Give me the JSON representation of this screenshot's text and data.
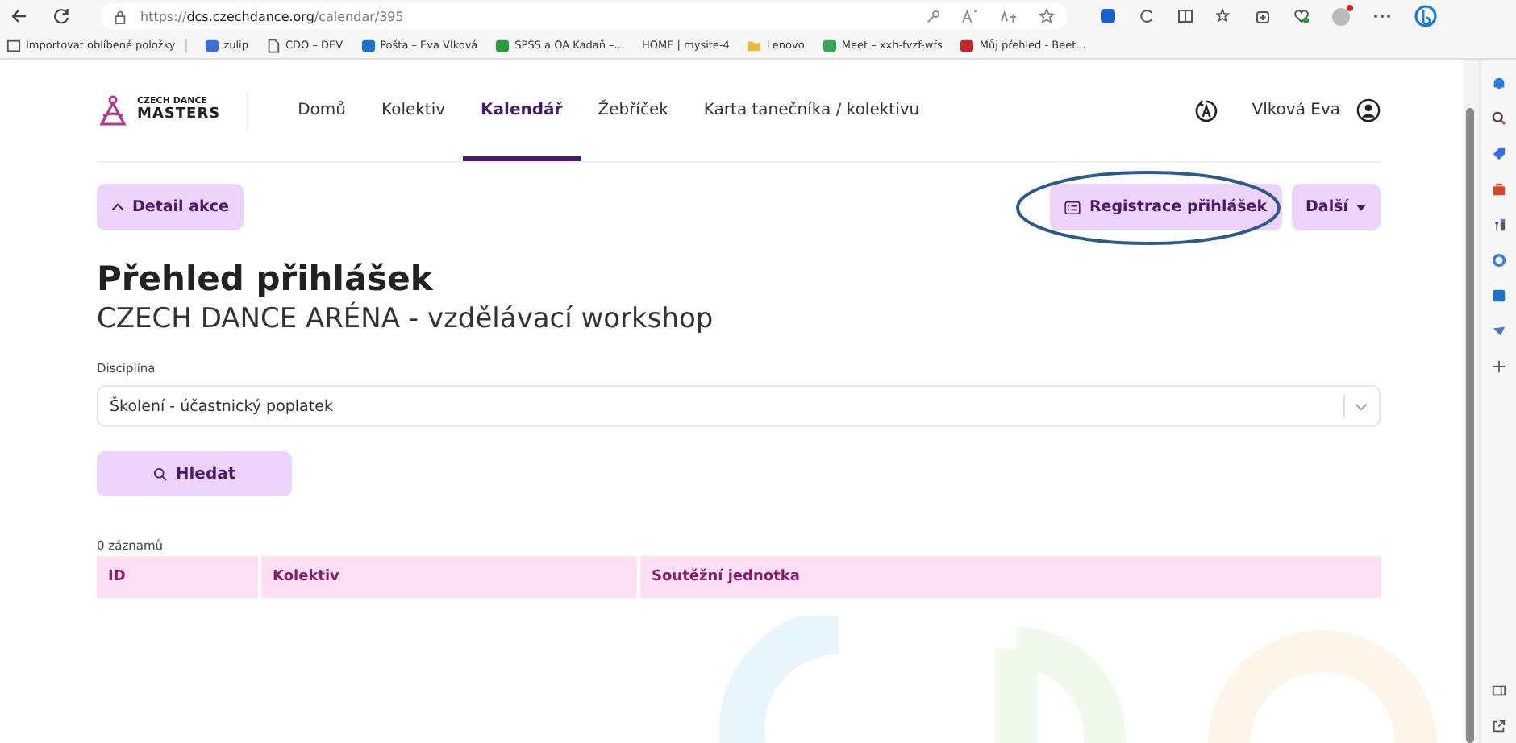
{
  "browser": {
    "url": "https://**dcs.czechdance.org**/calendar/395",
    "bookmarks": [
      {
        "label": "Importovat oblíbené položky",
        "kind": "import"
      },
      {
        "label": "zulip",
        "kind": "zulip"
      },
      {
        "label": "CDO – DEV",
        "kind": "page"
      },
      {
        "label": "Pošta – Eva Vlková",
        "kind": "mail"
      },
      {
        "label": "SPŠS a OA Kadaň –...",
        "kind": "school"
      },
      {
        "label": "HOME | mysite-4",
        "kind": "none"
      },
      {
        "label": "Lenovo",
        "kind": "folder"
      },
      {
        "label": "Meet – xxh-fvzf-wfs",
        "kind": "meet"
      },
      {
        "label": "Můj přehled - Beet...",
        "kind": "beet"
      }
    ],
    "profile_badge": true
  },
  "site": {
    "logo": {
      "line_1": "CZECH DANCE",
      "line_2": "MASTERS"
    },
    "nav": [
      {
        "label": "Domů",
        "selected": false
      },
      {
        "label": "Kolektiv",
        "selected": false
      },
      {
        "label": "Kalendář",
        "selected": true
      },
      {
        "label": "Žebříček",
        "selected": false
      },
      {
        "label": "Karta tanečníka / kolektivu",
        "selected": false
      }
    ],
    "user": "Vlková Eva"
  },
  "toolbar": {
    "back_button": "Detail akce",
    "register_button": "Registrace přihlášek",
    "more_button": "Další",
    "annotation_circled": true
  },
  "title": "Přehled přihlášek",
  "subtitle": "CZECH DANCE ARÉNA - vzdělávací workshop",
  "filter": {
    "label": "Disciplína",
    "value": "Školení - účastnický poplatek"
  },
  "search_button": "Hledat",
  "count": "0 záznamů",
  "table": {
    "columns": [
      "ID",
      "Kolektiv",
      "Soutěžní jednotka"
    ]
  }
}
